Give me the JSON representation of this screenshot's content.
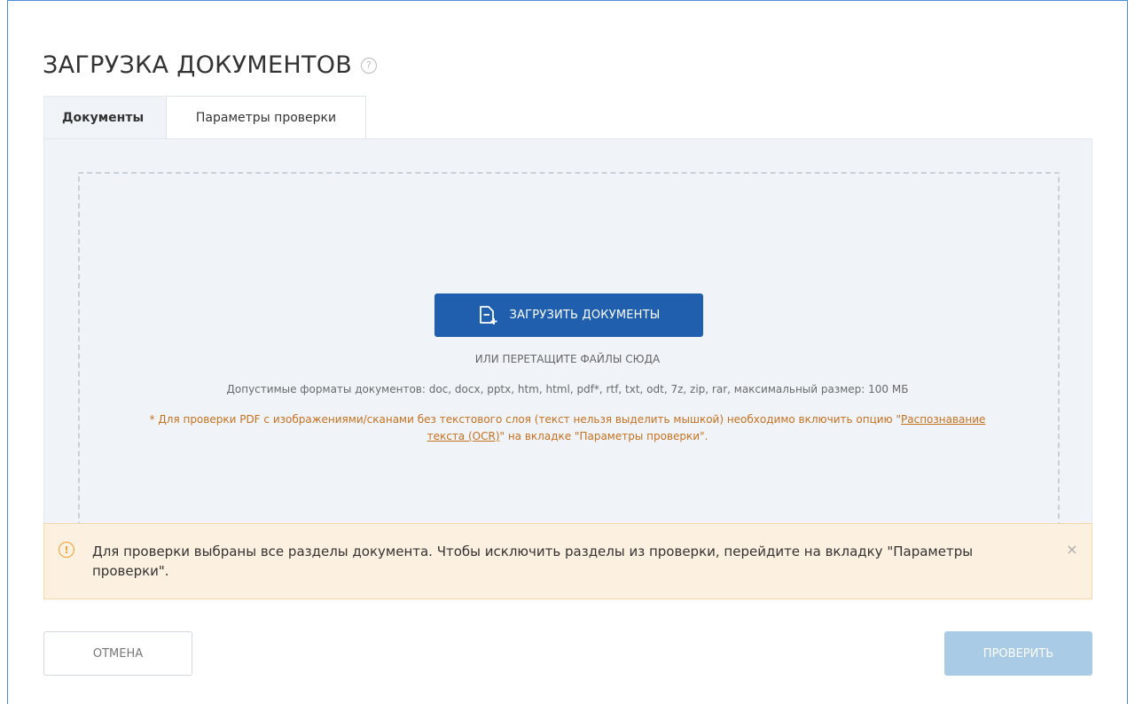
{
  "page": {
    "title": "ЗАГРУЗКА ДОКУМЕНТОВ",
    "help_icon": "question-circle-icon"
  },
  "tabs": [
    {
      "label": "Документы",
      "active": true
    },
    {
      "label": "Параметры проверки",
      "active": false
    }
  ],
  "dropzone": {
    "upload_button_label": "ЗАГРУЗИТЬ ДОКУМЕНТЫ",
    "upload_icon": "document-add-icon",
    "drag_hint": "ИЛИ ПЕРЕТАЩИТЕ ФАЙЛЫ СЮДА",
    "formats_text": "Допустимые форматы документов: doc, docx, pptx, htm, html, pdf*, rtf, txt, odt, 7z, zip, rar, максимальный размер: 100 МБ",
    "pdf_note_before": "* Для проверки PDF с изображениями/сканами без текстового слоя (текст нельзя выделить мышкой) необходимо включить опцию \"",
    "pdf_note_link": "Распознавание текста (OCR)",
    "pdf_note_after": "\" на вкладке \"Параметры проверки\"."
  },
  "alert": {
    "icon": "info-circle-icon",
    "text": "Для проверки выбраны все разделы документа. Чтобы исключить разделы из проверки, перейдите на вкладку \"Параметры проверки\".",
    "close_icon": "close-icon"
  },
  "footer": {
    "cancel_label": "ОТМЕНА",
    "check_label": "ПРОВЕРИТЬ"
  },
  "colors": {
    "primary": "#1f5fae",
    "primary_disabled": "#a9cbe6",
    "warning_text": "#c7701e",
    "alert_bg": "#fcf0e0"
  }
}
